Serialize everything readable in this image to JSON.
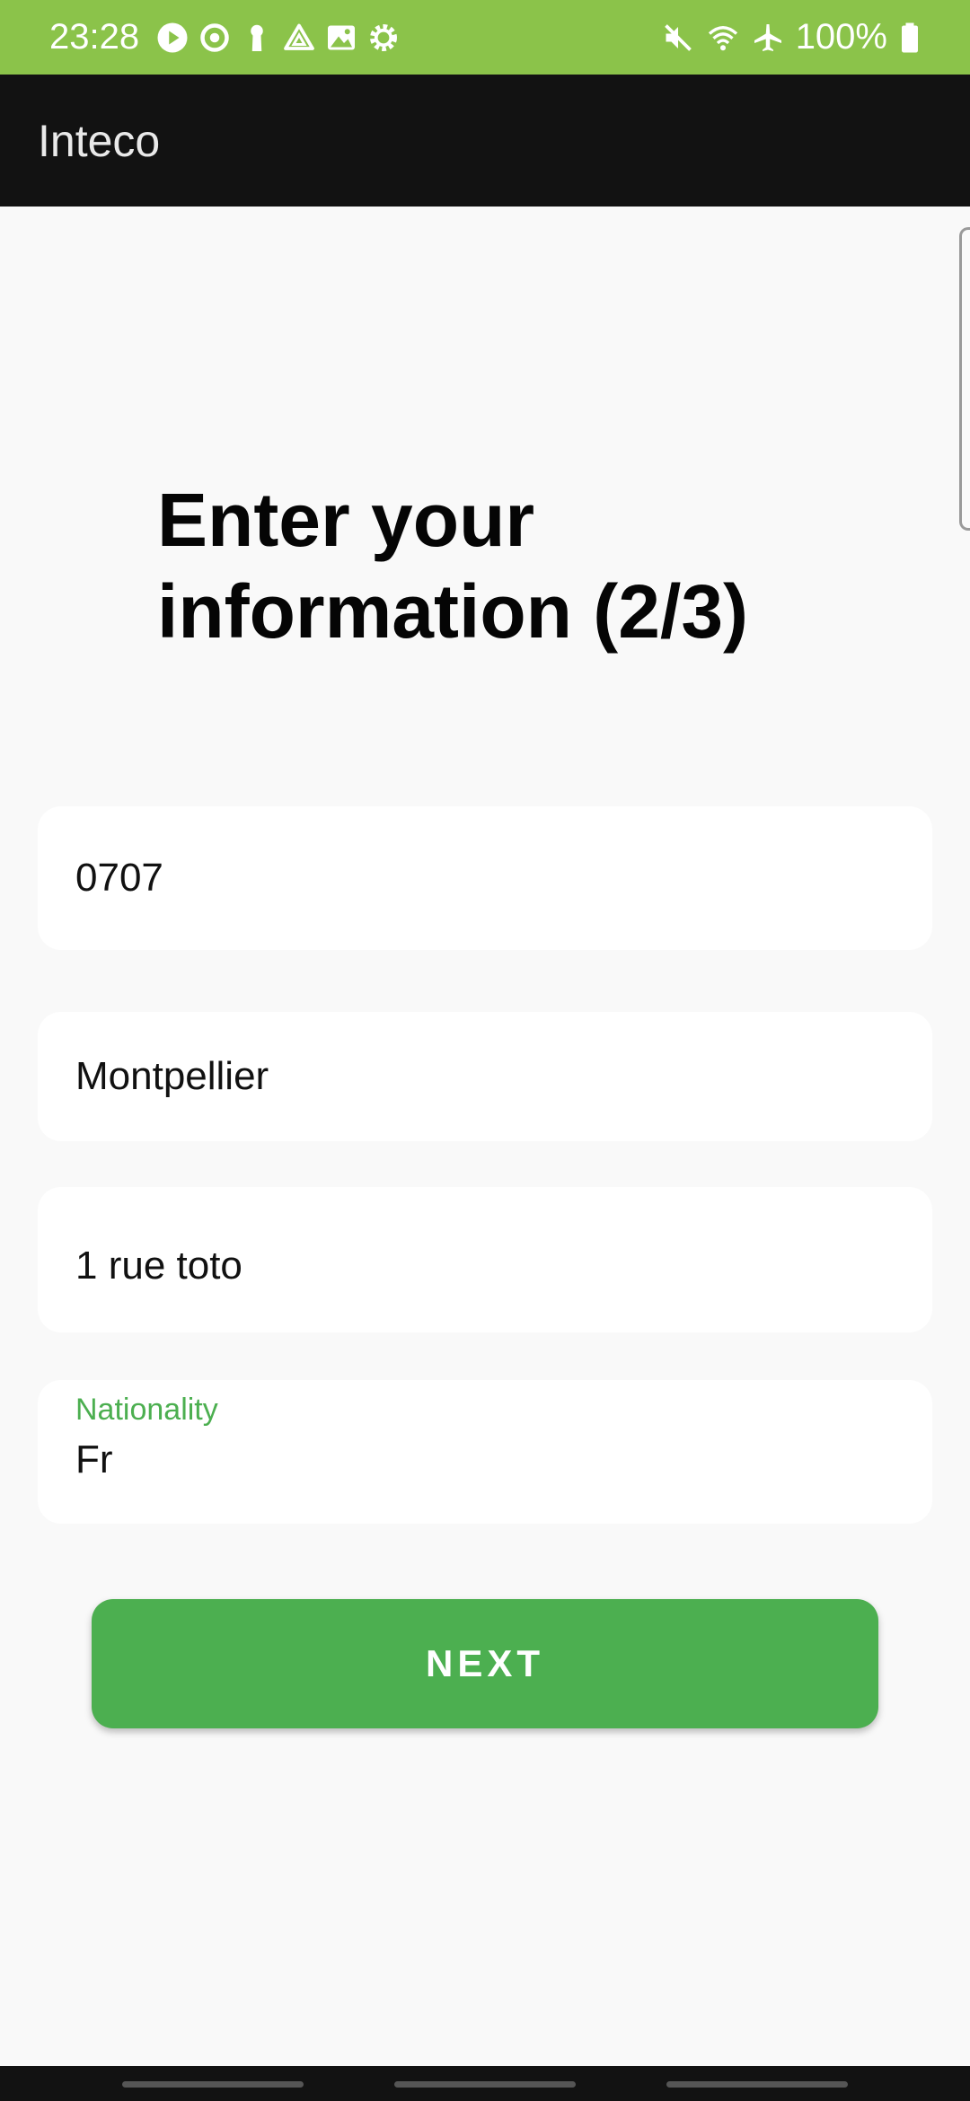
{
  "status_bar": {
    "time": "23:28",
    "left_icons": [
      "play-icon",
      "sync-icon",
      "keyhole-icon",
      "drive-icon",
      "image-icon",
      "settings-icon"
    ],
    "right_icons": [
      "mute-icon",
      "wifi-icon",
      "airplane-icon",
      "battery-icon"
    ],
    "battery": "100%",
    "color": "#8bc34a"
  },
  "app_bar": {
    "title": "Inteco",
    "color": "#121212"
  },
  "form": {
    "heading": "Enter your information (2/3)",
    "fields": [
      {
        "value": "0707"
      },
      {
        "value": "Montpellier"
      },
      {
        "value": "1 rue toto"
      },
      {
        "label": "Nationality",
        "value": "Fr"
      }
    ],
    "next_label": "NEXT",
    "accent_color": "#4caf50"
  }
}
